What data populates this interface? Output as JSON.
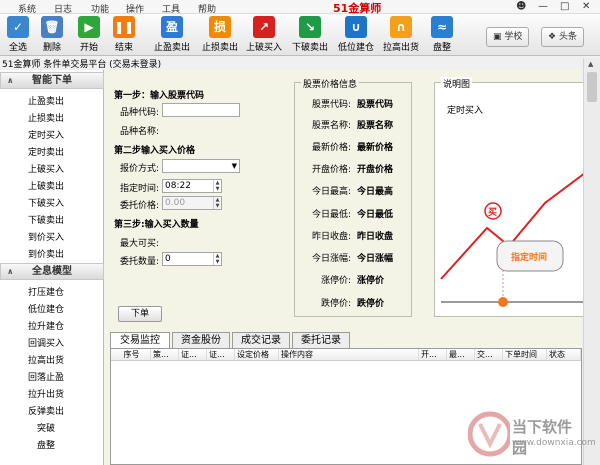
{
  "menu": [
    "系统",
    "日志",
    "功能",
    "操作",
    "工具",
    "帮助"
  ],
  "brand": "51金算师",
  "toolbar": {
    "buttons": [
      {
        "label": "全选",
        "icon": "select-all-icon"
      },
      {
        "label": "删除",
        "icon": "delete-icon"
      },
      {
        "label": "开始",
        "icon": "start-icon"
      },
      {
        "label": "结束",
        "icon": "stop-icon"
      },
      {
        "label": "止盈卖出",
        "icon": "take-profit-icon"
      },
      {
        "label": "止损卖出",
        "icon": "stop-loss-icon"
      },
      {
        "label": "上破买入",
        "icon": "break-up-buy-icon"
      },
      {
        "label": "下破卖出",
        "icon": "break-down-sell-icon"
      },
      {
        "label": "低位建仓",
        "icon": "low-build-icon"
      },
      {
        "label": "拉高出货",
        "icon": "pull-up-sell-icon"
      },
      {
        "label": "盘整",
        "icon": "consolidation-icon"
      }
    ],
    "school": "学校",
    "headlines": "头条"
  },
  "status": "51金算师 条件单交易平台 (交易未登录)",
  "sidebar": {
    "group1": "智能下单",
    "items1": [
      "止盈卖出",
      "止损卖出",
      "定时买入",
      "定时卖出",
      "上破买入",
      "上破卖出",
      "下破买入",
      "下破卖出",
      "到价买入",
      "到价卖出"
    ],
    "group2": "全息模型",
    "items2": [
      "打压建仓",
      "低位建仓",
      "拉升建仓",
      "回调买入",
      "拉高出货",
      "回落止盈",
      "拉升出货",
      "反弹卖出",
      "突破",
      "盘整"
    ]
  },
  "form": {
    "step1": "第一步：输入股票代码",
    "code_label": "品种代码:",
    "name_label": "品种名称:",
    "step2": "第二步输入买入价格",
    "quote_label": "报价方式:",
    "time_label": "指定时间:",
    "time_value": "08:22",
    "price_label": "委托价格:",
    "price_value": "0.00",
    "step3": "第三步:输入买入数量",
    "maxbuy_label": "最大可买:",
    "qty_label": "委托数量:",
    "qty_value": "0",
    "submit": "下单"
  },
  "stockinfo": {
    "title": "股票价格信息",
    "rows": [
      {
        "label": "股票代码:",
        "value": "股票代码"
      },
      {
        "label": "股票名称:",
        "value": "股票名称"
      },
      {
        "label": "最新价格:",
        "value": "最新价格"
      },
      {
        "label": "开盘价格:",
        "value": "开盘价格"
      },
      {
        "label": "今日最高:",
        "value": "今日最高"
      },
      {
        "label": "今日最低:",
        "value": "今日最低"
      },
      {
        "label": "昨日收盘:",
        "value": "昨日收盘"
      },
      {
        "label": "今日涨幅:",
        "value": "今日涨幅"
      },
      {
        "label": "涨停价:",
        "value": "涨停价"
      },
      {
        "label": "跌停价:",
        "value": "跌停价"
      }
    ]
  },
  "diagram": {
    "title": "说明图",
    "caption": "定时买入",
    "buy_marker": "买",
    "callout": "指定时间",
    "colors": {
      "line": "#e02020",
      "marker": "#f07820"
    }
  },
  "tabs": [
    "交易监控",
    "资金股份",
    "成交记录",
    "委托记录"
  ],
  "columns": [
    "序号",
    "策...",
    "证...",
    "证...",
    "设定价格",
    "操作内容",
    "开...",
    "最...",
    "交...",
    "下单时间",
    "状态"
  ],
  "watermark": {
    "name": "当下软件园",
    "url": "www.downxia.com"
  }
}
